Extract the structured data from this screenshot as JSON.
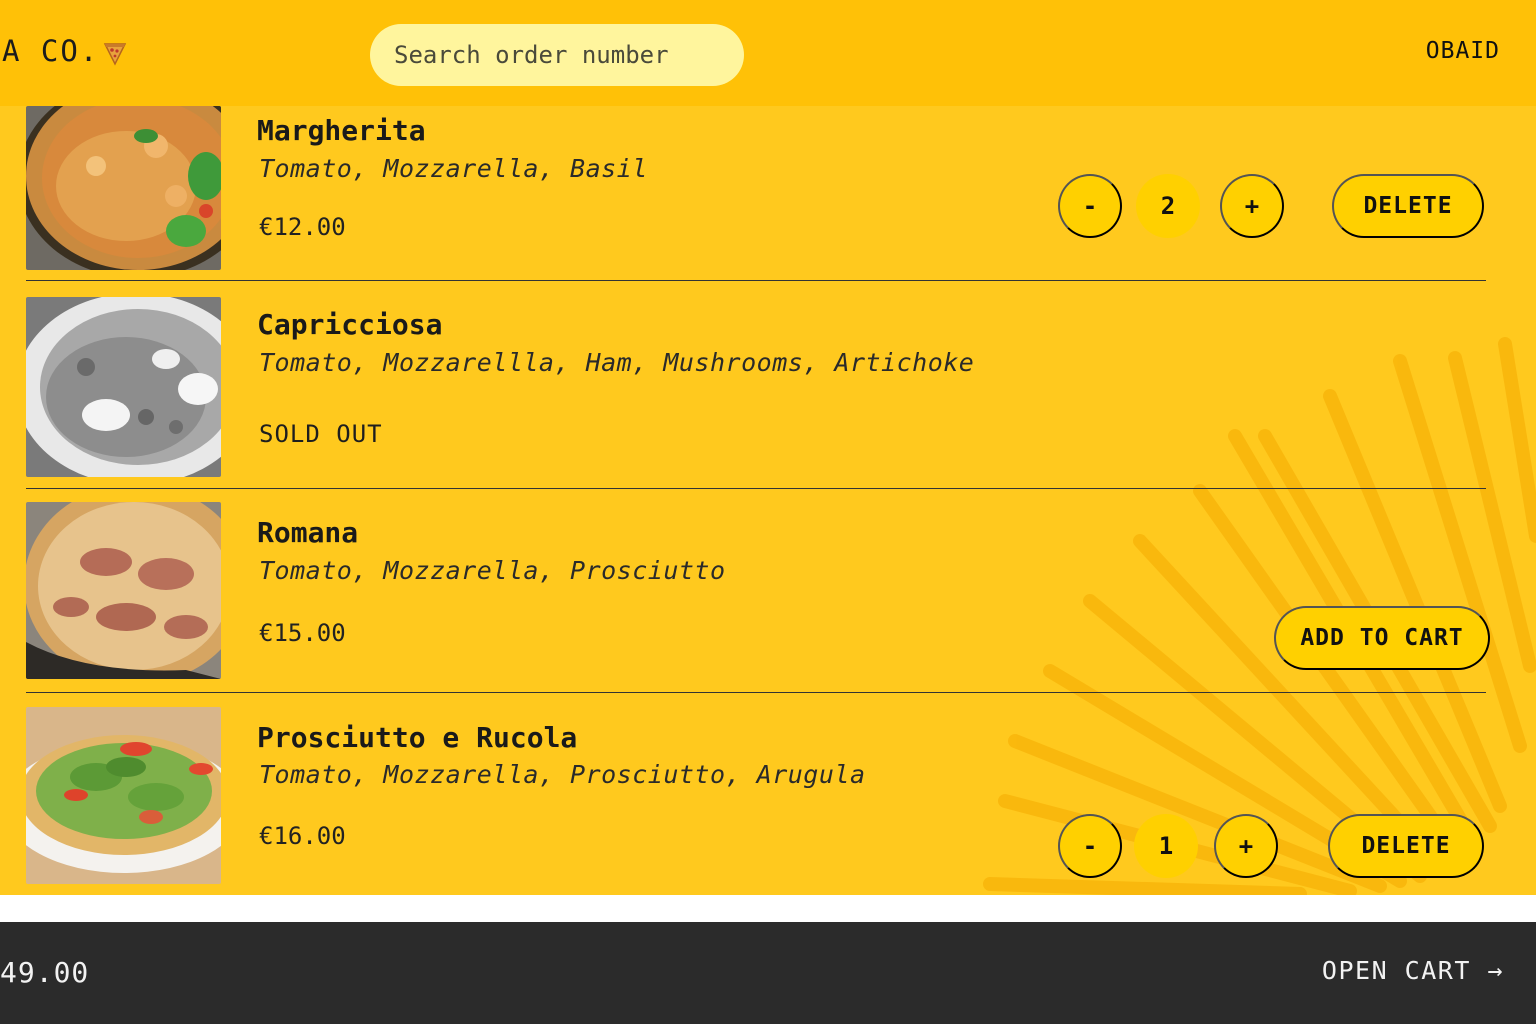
{
  "header": {
    "logo_text": "A CO.",
    "search_placeholder": "Search order number",
    "username": "OBAID"
  },
  "items": [
    {
      "name": "Margherita",
      "ingredients": "Tomato, Mozzarella, Basil",
      "price": "€12.00",
      "quantity": "2",
      "minus_label": "-",
      "plus_label": "+",
      "delete_label": "DELETE"
    },
    {
      "name": "Capricciosa",
      "ingredients": "Tomato, Mozzarellla, Ham, Mushrooms, Artichoke",
      "status": "SOLD OUT"
    },
    {
      "name": "Romana",
      "ingredients": "Tomato, Mozzarella, Prosciutto",
      "price": "€15.00",
      "add_label": "ADD TO CART"
    },
    {
      "name": "Prosciutto e Rucola",
      "ingredients": "Tomato, Mozzarella, Prosciutto, Arugula",
      "price": "€16.00",
      "quantity": "1",
      "minus_label": "-",
      "plus_label": "+",
      "delete_label": "DELETE"
    }
  ],
  "footer": {
    "total": "49.00",
    "open_cart_label": "OPEN CART →"
  },
  "colors": {
    "header_bg": "#ffc107",
    "list_bg": "#ffc91e",
    "button_bg": "#ffd000",
    "search_bg": "#fff59d",
    "footer_bg": "#2b2b2b"
  }
}
